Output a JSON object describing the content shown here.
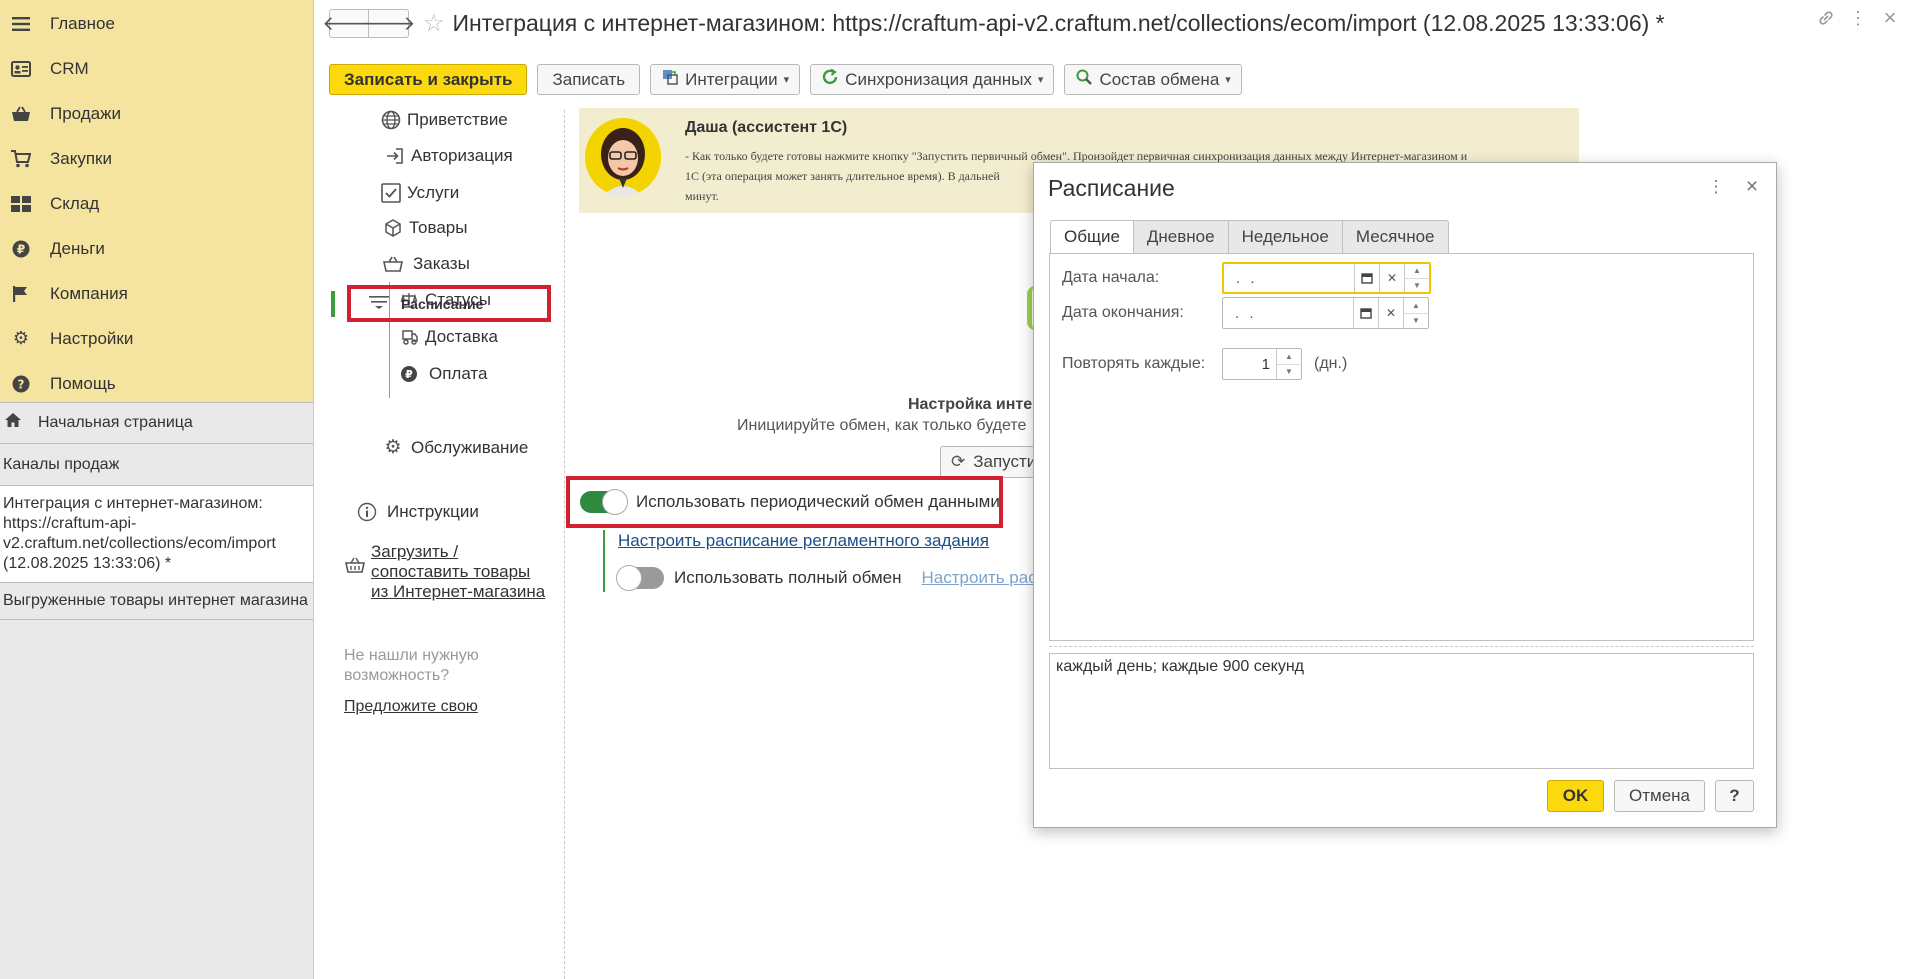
{
  "sidebar": {
    "sections": [
      {
        "label": "Главное",
        "icon": "menu-icon"
      },
      {
        "label": "CRM",
        "icon": "contact-card-icon"
      },
      {
        "label": "Продажи",
        "icon": "basket-icon"
      },
      {
        "label": "Закупки",
        "icon": "cart-icon"
      },
      {
        "label": "Склад",
        "icon": "warehouse-icon"
      },
      {
        "label": "Деньги",
        "icon": "ruble-icon"
      },
      {
        "label": "Компания",
        "icon": "flag-icon"
      },
      {
        "label": "Настройки",
        "icon": "gear-icon"
      },
      {
        "label": "Помощь",
        "icon": "help-icon"
      }
    ],
    "home": "Начальная страница",
    "open_windows": [
      "Каналы продаж",
      "Интеграция с интернет-магазином: https://craftum-api-v2.craftum.net/collections/ecom/import (12.08.2025 13:33:06) *",
      "Выгруженные товары интернет магазина"
    ]
  },
  "header": {
    "title": "Интеграция с интернет-магазином: https://craftum-api-v2.craftum.net/collections/ecom/import (12.08.2025 13:33:06) *"
  },
  "toolbar": {
    "save_close": "Записать и закрыть",
    "save": "Записать",
    "integrations": "Интеграции",
    "sync": "Синхронизация данных",
    "exchange": "Состав обмена"
  },
  "nav": {
    "welcome": "Приветствие",
    "auth": "Авторизация",
    "services": "Услуги",
    "goods": "Товары",
    "orders": "Заказы",
    "statuses": "Статусы",
    "delivery": "Доставка",
    "payment": "Оплата",
    "schedule": "Расписание",
    "maintenance": "Обслуживание",
    "instructions": "Инструкции",
    "load_line1": "Загрузить /",
    "load_line2": "сопоставить товары",
    "load_line3": "из Интернет-магазина",
    "not_found_line1": "Не нашли нужную",
    "not_found_line2": "возможность?",
    "suggest": "Предложите свою"
  },
  "assistant": {
    "name": "Даша (ассистент 1С)",
    "line1": "-  Как только будете готовы нажмите кнопку \"Запустить первичный обмен\". Произойдет первичная синхронизация данных между Интернет-магазином и",
    "line2": "1С (эта операция может занять длительное время). В дальней",
    "line3": "минут."
  },
  "content": {
    "setup_title": "Настройка инте",
    "setup_sub": "Инициируйте обмен, как только будете",
    "start_btn": "Запусти",
    "periodic": "Использовать периодический обмен данными",
    "schedule_link": "Настроить расписание регламентного задания",
    "full_exchange": "Использовать полный обмен",
    "full_link": "Настроить распи"
  },
  "dialog": {
    "title": "Расписание",
    "tabs": [
      "Общие",
      "Дневное",
      "Недельное",
      "Месячное"
    ],
    "start_label": "Дата начала:",
    "start_value": ". .",
    "end_label": "Дата окончания:",
    "end_value": ". .",
    "repeat_label": "Повторять каждые:",
    "repeat_value": "1",
    "repeat_unit": "(дн.)",
    "summary": "каждый день; каждые 900 секунд",
    "ok": "OK",
    "cancel": "Отмена",
    "help": "?"
  },
  "colors": {
    "sidebar_sections_bg": "#f5e49f",
    "primary_button": "#fbd90c",
    "highlight_frame": "#d32030",
    "toggle_on": "#2e8a3e"
  }
}
